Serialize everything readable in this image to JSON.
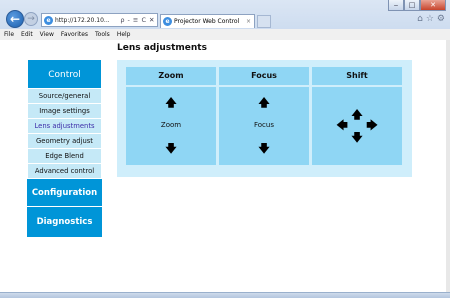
{
  "browser": {
    "address": "http://172.20.10...",
    "address_tools": "ρ ‑ ≡ C ✕",
    "tab_title": "Projector Web Control",
    "tab_close": "×",
    "window_buttons": [
      "‒",
      "□",
      "✕"
    ],
    "right_icons": [
      "⌂",
      "☆",
      "⚙"
    ],
    "menu": [
      "File",
      "Edit",
      "View",
      "Favorites",
      "Tools",
      "Help"
    ]
  },
  "page_title": "Lens adjustments",
  "sidebar": {
    "header": "Control",
    "items": [
      {
        "label": "Source/general"
      },
      {
        "label": "Image settings"
      },
      {
        "label": "Lens adjustments"
      },
      {
        "label": "Geometry adjust"
      },
      {
        "label": "Edge Blend"
      },
      {
        "label": "Advanced control"
      }
    ],
    "configuration": "Configuration",
    "diagnostics": "Diagnostics"
  },
  "lens": {
    "zoom": {
      "header": "Zoom",
      "label": "Zoom",
      "up": "🠉",
      "down": "🠋"
    },
    "focus": {
      "header": "Focus",
      "label": "Focus",
      "up": "🠉",
      "down": "🠋"
    },
    "shift": {
      "header": "Shift",
      "up": "🠉",
      "down": "🠋",
      "left": "🠈",
      "right": "🠊"
    }
  }
}
